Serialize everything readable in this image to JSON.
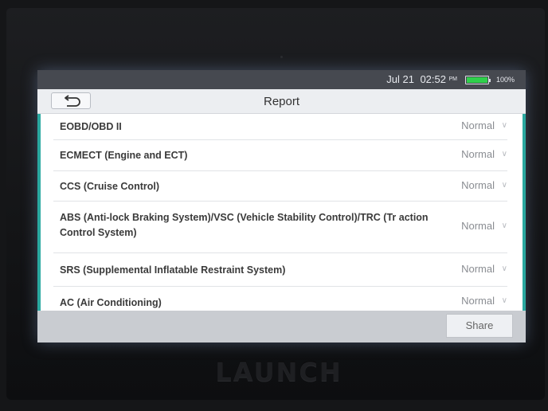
{
  "status": {
    "date": "Jul 21",
    "time": "02:52",
    "ampm": "PM",
    "battery": "100%",
    "battery_color": "#2fd04b"
  },
  "titlebar": {
    "back_icon": "back-arrow-icon",
    "title": "Report"
  },
  "systems": [
    {
      "label": "EOBD/OBD II",
      "status": "Normal"
    },
    {
      "label": "ECMECT (Engine and ECT)",
      "status": "Normal"
    },
    {
      "label": "CCS (Cruise Control)",
      "status": "Normal"
    },
    {
      "label": "ABS (Anti-lock Braking System)/VSC (Vehicle Stability Control)/TRC (Tr action Control System)",
      "status": "Normal"
    },
    {
      "label": "SRS (Supplemental Inflatable Restraint System)",
      "status": "Normal"
    },
    {
      "label": "AC (Air Conditioning)",
      "status": "Normal"
    }
  ],
  "footer": {
    "share_label": "Share"
  },
  "device": {
    "brand": "LAUNCH"
  },
  "colors": {
    "accent": "#2aa8a0",
    "statusbar": "#464950"
  }
}
